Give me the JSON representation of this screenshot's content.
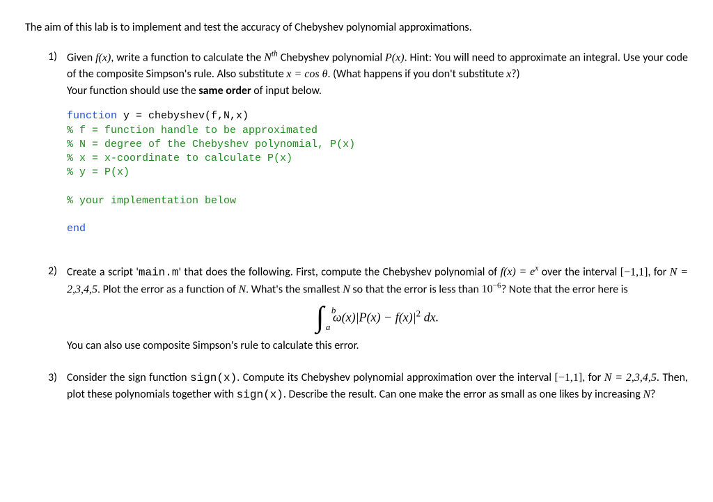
{
  "intro": "The aim of this lab is to implement and test the accuracy of Chebyshev polynomial approximations.",
  "items": [
    {
      "num": "1)",
      "para1_pre": "Given ",
      "para1_fx1": "f(x)",
      "para1_mid1": ", write a function to calculate the ",
      "para1_nth_base": "N",
      "para1_nth_sup": "th",
      "para1_mid2": " Chebyshev polynomial ",
      "para1_px": "P(x)",
      "para1_mid3": ". Hint: You will need to approximate an integral. Use your code of the composite Simpson's rule. Also substitute ",
      "para1_sub": "x = cos θ",
      "para1_mid4": ". (What happens if you don't substitute ",
      "para1_x": "x",
      "para1_end": "?)",
      "para2": "Your function should use the ",
      "para2_bold": "same order",
      "para2_end": " of input below.",
      "code": {
        "l1_kw": "function",
        "l1_rest": " y = chebyshev(f,N,x)",
        "l2": "% f = function handle to be approximated",
        "l3": "% N = degree of the Chebyshev polynomial, P(x)",
        "l4": "% x = x-coordinate to calculate P(x)",
        "l5": "% y = P(x)",
        "l6": "% your implementation below",
        "l7_kw": "end"
      }
    },
    {
      "num": "2)",
      "p1_a": "Create a script '",
      "p1_mono": "main.m",
      "p1_b": "' that does the following. First, compute the Chebyshev polynomial of ",
      "p1_fx": "f(x) = e",
      "p1_fx_sup": "x",
      "p1_c": " over the interval ",
      "p1_int": "[−1,1]",
      "p1_d": ", for ",
      "p1_N": "N = 2,3,4,5",
      "p1_e": ". Plot the error as a function of ",
      "p1_Nv": "N",
      "p1_f": ". What's the smallest ",
      "p1_Nv2": "N",
      "p1_g": " so that the error is less than ",
      "p1_ten": "10",
      "p1_exp": "−6",
      "p1_h": "? Note that the error here is",
      "eq": {
        "a": "a",
        "b": "b",
        "body": "ω(x)|P(x) − f(x)|",
        "sq": "2",
        "dx": " dx."
      },
      "p2": "You can also use composite Simpson's rule to calculate this error."
    },
    {
      "num": "3)",
      "p_a": "Consider the sign function ",
      "p_mono1": "sign(x)",
      "p_b": ". Compute its Chebyshev polynomial approximation over the interval ",
      "p_int": "[−1,1]",
      "p_c": ", for ",
      "p_N": "N = 2,3,4,5",
      "p_d": ". Then, plot these polynomials together with ",
      "p_mono2": "sign(x)",
      "p_e": ". Describe the result. Can one make the error as small as one likes by increasing ",
      "p_Nv": "N",
      "p_f": "?"
    }
  ]
}
